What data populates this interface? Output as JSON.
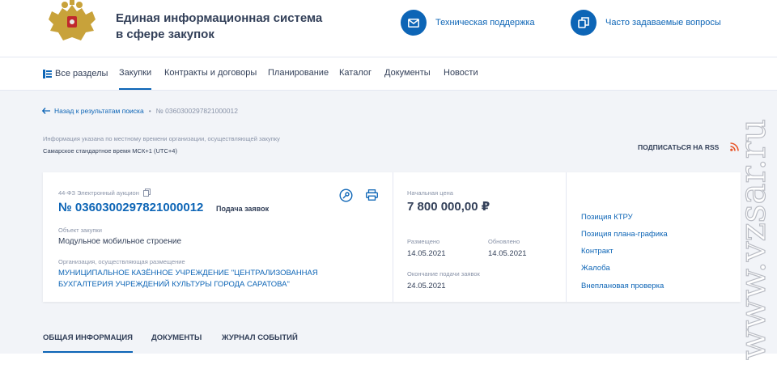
{
  "header": {
    "title_line1": "Единая информационная система",
    "title_line2": "в сфере закупок",
    "support_label": "Техническая поддержка",
    "faq_label": "Часто задаваемые вопросы",
    "accent": "#0d65b6"
  },
  "nav": {
    "items": [
      {
        "label": "Все разделы"
      },
      {
        "label": "Закупки"
      },
      {
        "label": "Контракты и договоры"
      },
      {
        "label": "Планирование"
      },
      {
        "label": "Каталог"
      },
      {
        "label": "Документы"
      },
      {
        "label": "Новости"
      }
    ],
    "active": "Закупки"
  },
  "breadcrumb": {
    "back_label": "Назад к результатам поиска",
    "separator": "•",
    "current": "№ 0360300297821000012"
  },
  "timezone": {
    "note": "Информация указана по местному времени организации, осуществляющей закупку",
    "value": "Самарское стандартное время МСК+1 (UTC+4)"
  },
  "rss": {
    "label": "ПОДПИСАТЬСЯ НА RSS"
  },
  "card": {
    "law": "44-ФЗ Электронный аукцион",
    "reg_number": "№ 0360300297821000012",
    "stage": "Подача заявок",
    "object_label": "Объект закупки",
    "object_value": "Модульное мобильное строение",
    "org_label": "Организация, осуществляющая размещение",
    "org_value": "МУНИЦИПАЛЬНОЕ КАЗЁННОЕ УЧРЕЖДЕНИЕ \"ЦЕНТРАЛИЗОВАННАЯ БУХГАЛТЕРИЯ УЧРЕЖДЕНИЙ КУЛЬТУРЫ ГОРОДА САРАТОВА\"",
    "price_label": "Начальная цена",
    "price_value": "7 800 000,00 ₽",
    "posted_label": "Размещено",
    "posted_value": "14.05.2021",
    "updated_label": "Обновлено",
    "updated_value": "14.05.2021",
    "deadline_label": "Окончание подачи заявок",
    "deadline_value": "24.05.2021",
    "links": [
      {
        "label": "Позиция КТРУ"
      },
      {
        "label": "Позиция плана-графика"
      },
      {
        "label": "Контракт"
      },
      {
        "label": "Жалоба"
      },
      {
        "label": "Внеплановая проверка"
      }
    ]
  },
  "tabs": [
    {
      "label": "ОБЩАЯ ИНФОРМАЦИЯ"
    },
    {
      "label": "ДОКУМЕНТЫ"
    },
    {
      "label": "ЖУРНАЛ СОБЫТИЙ"
    }
  ],
  "watermark": {
    "text": "www.vzsar.ru"
  }
}
